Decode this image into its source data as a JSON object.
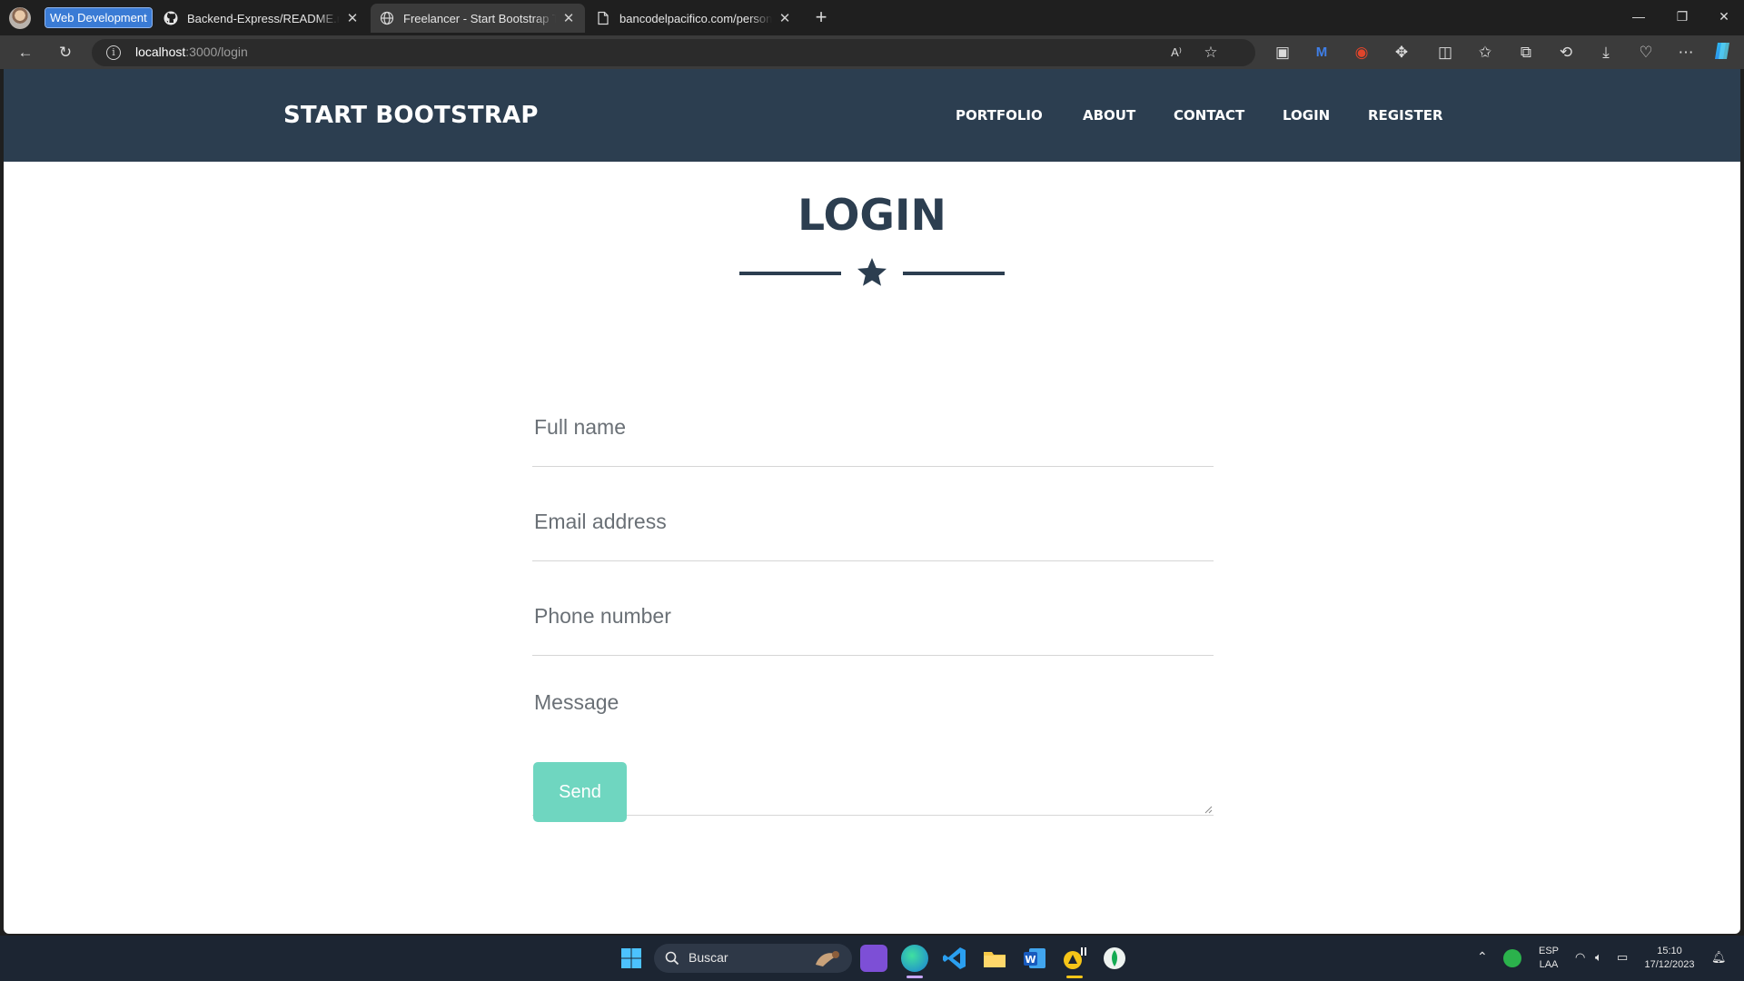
{
  "browser": {
    "tab_group_label": "Web Development",
    "tabs": [
      {
        "title": "Backend-Express/README.md at",
        "icon": "github-icon",
        "active": false
      },
      {
        "title": "Freelancer - Start Bootstrap Then",
        "icon": "globe-icon",
        "active": true
      },
      {
        "title": "bancodelpacifico.com/personas/",
        "icon": "page-icon",
        "active": false
      }
    ],
    "address": {
      "host": "localhost",
      "path": ":3000/login"
    }
  },
  "site": {
    "brand": "START BOOTSTRAP",
    "nav": [
      "PORTFOLIO",
      "ABOUT",
      "CONTACT",
      "LOGIN",
      "REGISTER"
    ],
    "colors": {
      "navbar": "#2c3e50",
      "accent": "#6fd6c0"
    }
  },
  "login": {
    "title": "LOGIN",
    "fields": {
      "full_name": "Full name",
      "email": "Email address",
      "phone": "Phone number",
      "message": "Message"
    },
    "submit_label": "Send"
  },
  "taskbar": {
    "search_placeholder": "Buscar",
    "language": "ESP",
    "layout": "LAA",
    "time": "15:10",
    "date": "17/12/2023"
  }
}
